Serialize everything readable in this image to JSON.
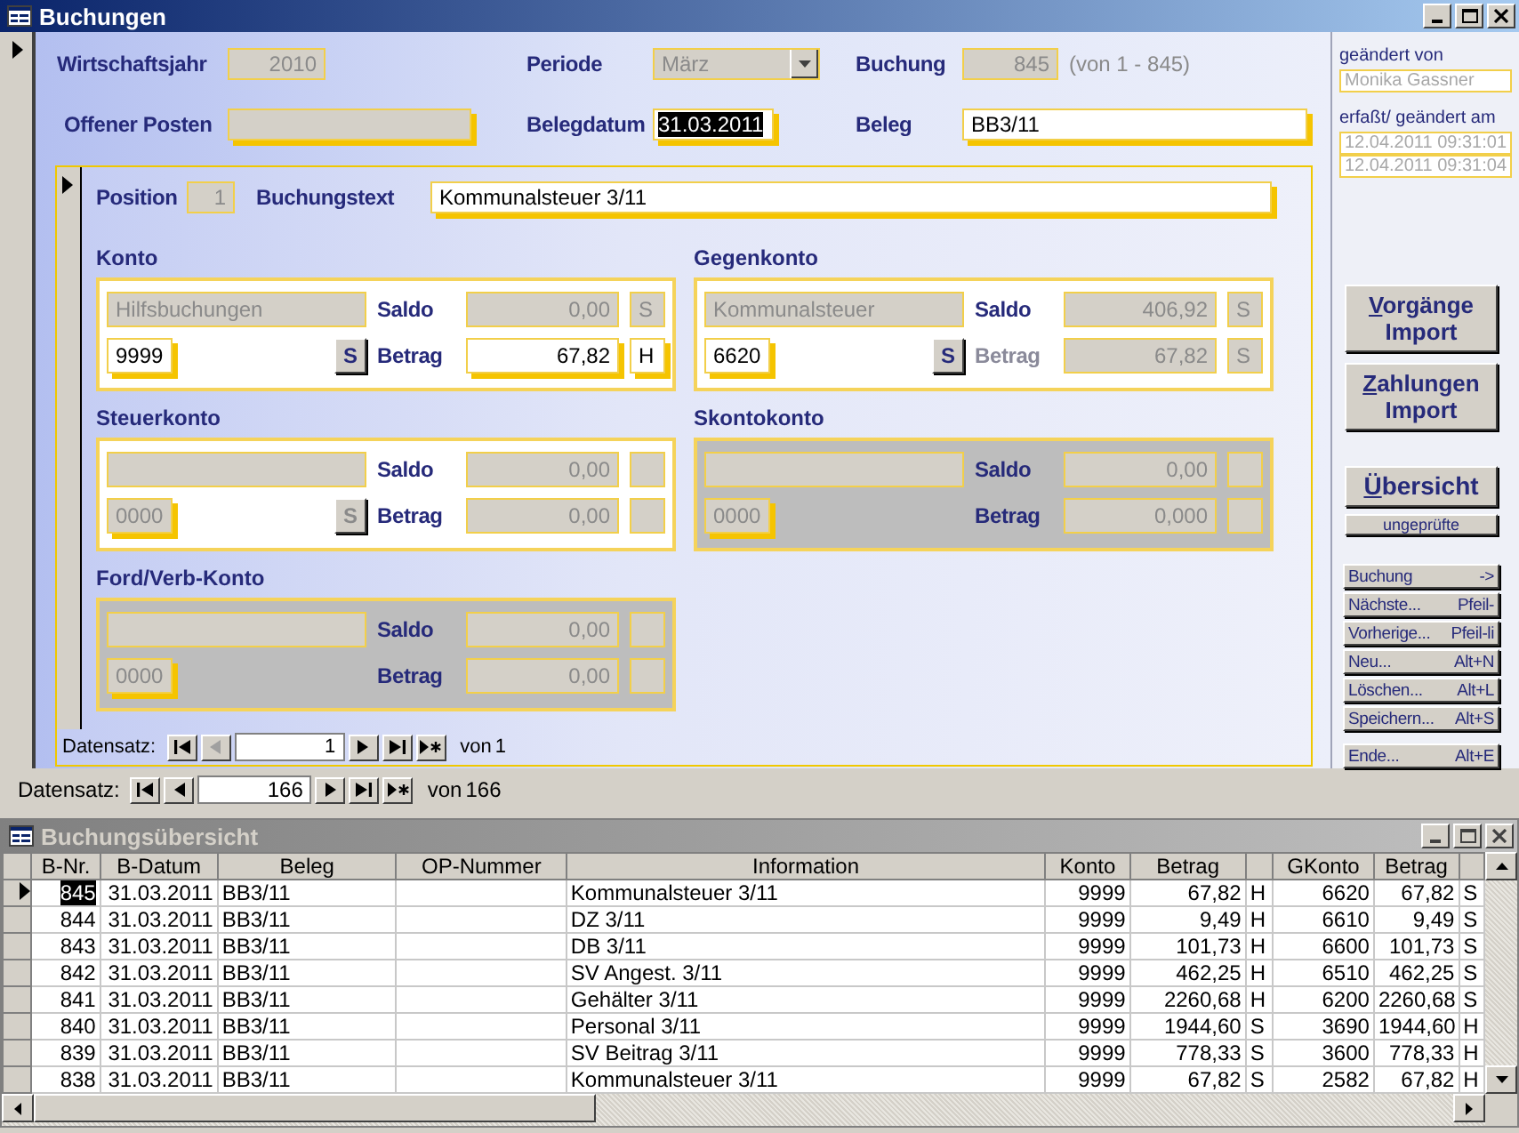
{
  "window": {
    "title": "Buchungen",
    "active": true
  },
  "header": {
    "fiscal_year": {
      "label": "Wirtschaftsjahr",
      "value": "2010"
    },
    "period": {
      "label": "Periode",
      "value": "März"
    },
    "booking": {
      "label": "Buchung",
      "value": "845",
      "range": "(von 1 - 845)"
    },
    "open_item": {
      "label": "Offener Posten"
    },
    "doc_date": {
      "label": "Belegdatum",
      "value": "31.03.2011",
      "selected": true
    },
    "doc": {
      "label": "Beleg",
      "value": "BB3/11"
    }
  },
  "audit": {
    "changed_by_label": "geändert von",
    "changed_by": "Monika Gassner",
    "dates_label": "erfaßt/ geändert am",
    "dates": [
      "12.04.2011 09:31:01",
      "12.04.2011 09:31:04"
    ]
  },
  "position": {
    "label": "Position",
    "value": "1",
    "text_label": "Buchungstext",
    "text": "Kommunalsteuer 3/11"
  },
  "accounts": [
    {
      "title": "Konto",
      "disabled": false,
      "name": "Hilfsbuchungen",
      "number": "9999",
      "number_editable": true,
      "lookup": {
        "label": "S",
        "disabled": false
      },
      "saldo_label": "Saldo",
      "saldo": "0,00",
      "saldo_side": "S",
      "betrag_label": "Betrag",
      "betrag_label_disabled": false,
      "betrag": "67,82",
      "betrag_editable": true,
      "betrag_side": "H"
    },
    {
      "title": "Gegenkonto",
      "disabled": false,
      "name": "Kommunalsteuer",
      "number": "6620",
      "number_editable": true,
      "lookup": {
        "label": "S",
        "disabled": false
      },
      "saldo_label": "Saldo",
      "saldo": "406,92",
      "saldo_side": "S",
      "betrag_label": "Betrag",
      "betrag_label_disabled": true,
      "betrag": "67,82",
      "betrag_editable": false,
      "betrag_side": "S"
    },
    {
      "title": "Steuerkonto",
      "disabled": false,
      "number": "0000",
      "number_editable": false,
      "lookup": {
        "label": "S",
        "disabled": true
      },
      "saldo_label": "Saldo",
      "saldo": "0,00",
      "betrag_label": "Betrag",
      "betrag_label_disabled": false,
      "betrag": "0,00",
      "betrag_editable": false
    },
    {
      "title": "Skontokonto",
      "disabled": true,
      "number": "0000",
      "number_editable": false,
      "saldo_label": "Saldo",
      "saldo": "0,00",
      "betrag_label": "Betrag",
      "betrag_label_disabled": false,
      "betrag": "0,000",
      "betrag_editable": false
    },
    {
      "title": "Ford/Verb-Konto",
      "disabled": true,
      "number": "0000",
      "number_editable": false,
      "saldo_label": "Saldo",
      "saldo": "0,00",
      "betrag_label": "Betrag",
      "betrag_label_disabled": false,
      "betrag": "0,00",
      "betrag_editable": false
    }
  ],
  "subform_nav": {
    "label": "Datensatz:",
    "current": "1",
    "of_label": "von",
    "total": "1",
    "prev_disabled": true
  },
  "main_nav": {
    "label": "Datensatz:",
    "current": "166",
    "of_label": "von",
    "total": "166",
    "prev_disabled": false
  },
  "side_buttons": {
    "imports": [
      {
        "accel": "V",
        "rest": "orgänge Import"
      },
      {
        "accel": "Z",
        "rest": "ahlungen Import"
      }
    ],
    "overview": {
      "accel": "Ü",
      "rest": "bersicht"
    },
    "unchecked": "ungeprüfte",
    "commands": [
      {
        "label": "Buchung",
        "shortcut": "->"
      },
      {
        "label": "Nächste...",
        "shortcut": "Pfeil-"
      },
      {
        "label": "Vorherige...",
        "shortcut": "Pfeil-li"
      },
      {
        "label": "Neu...",
        "shortcut": "Alt+N"
      },
      {
        "label": "Löschen...",
        "shortcut": "Alt+L"
      },
      {
        "label": "Speichern...",
        "shortcut": "Alt+S"
      },
      {
        "label": "Ende...",
        "shortcut": "Alt+E"
      }
    ]
  },
  "list_window": {
    "title": "Buchungsübersicht",
    "active": false
  },
  "table": {
    "columns": [
      "B-Nr.",
      "B-Datum",
      "Beleg",
      "OP-Nummer",
      "Information",
      "Konto",
      "Betrag",
      "GKonto",
      "Betrag"
    ],
    "rows": [
      {
        "selected": true,
        "nr": "845",
        "date": "31.03.2011",
        "beleg": "BB3/11",
        "info": "Kommunalsteuer 3/11",
        "konto": "9999",
        "betrag": "67,82",
        "side": "H",
        "gkonto": "6620",
        "gbetrag": "67,82",
        "gside": "S"
      },
      {
        "selected": false,
        "nr": "844",
        "date": "31.03.2011",
        "beleg": "BB3/11",
        "info": "DZ 3/11",
        "konto": "9999",
        "betrag": "9,49",
        "side": "H",
        "gkonto": "6610",
        "gbetrag": "9,49",
        "gside": "S"
      },
      {
        "selected": false,
        "nr": "843",
        "date": "31.03.2011",
        "beleg": "BB3/11",
        "info": "DB 3/11",
        "konto": "9999",
        "betrag": "101,73",
        "side": "H",
        "gkonto": "6600",
        "gbetrag": "101,73",
        "gside": "S"
      },
      {
        "selected": false,
        "nr": "842",
        "date": "31.03.2011",
        "beleg": "BB3/11",
        "info": "SV Angest. 3/11",
        "konto": "9999",
        "betrag": "462,25",
        "side": "H",
        "gkonto": "6510",
        "gbetrag": "462,25",
        "gside": "S"
      },
      {
        "selected": false,
        "nr": "841",
        "date": "31.03.2011",
        "beleg": "BB3/11",
        "info": "Gehälter 3/11",
        "konto": "9999",
        "betrag": "2260,68",
        "side": "H",
        "gkonto": "6200",
        "gbetrag": "2260,68",
        "gside": "S"
      },
      {
        "selected": false,
        "nr": "840",
        "date": "31.03.2011",
        "beleg": "BB3/11",
        "info": "Personal 3/11",
        "konto": "9999",
        "betrag": "1944,60",
        "side": "S",
        "gkonto": "3690",
        "gbetrag": "1944,60",
        "gside": "H"
      },
      {
        "selected": false,
        "nr": "839",
        "date": "31.03.2011",
        "beleg": "BB3/11",
        "info": "SV Beitrag 3/11",
        "konto": "9999",
        "betrag": "778,33",
        "side": "S",
        "gkonto": "3600",
        "gbetrag": "778,33",
        "gside": "H"
      },
      {
        "selected": false,
        "nr": "838",
        "date": "31.03.2011",
        "beleg": "BB3/11",
        "info": "Kommunalsteuer 3/11",
        "konto": "9999",
        "betrag": "67,82",
        "side": "S",
        "gkonto": "2582",
        "gbetrag": "67,82",
        "gside": "H"
      }
    ]
  }
}
